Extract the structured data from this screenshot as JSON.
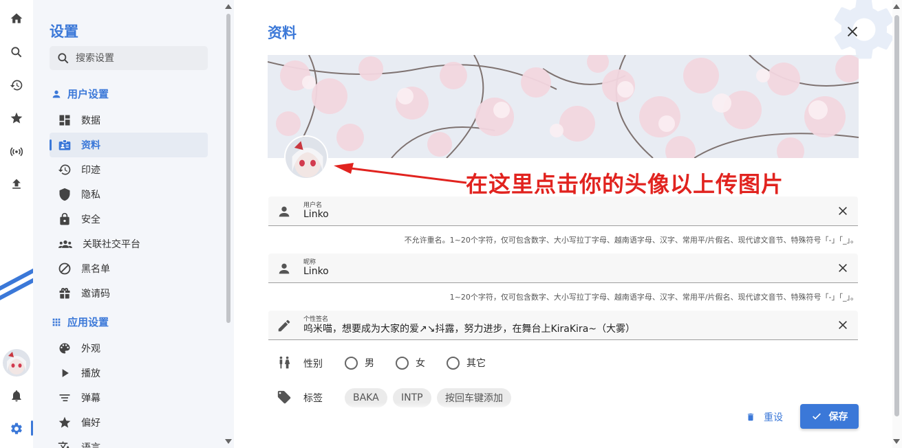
{
  "colors": {
    "accent": "#3b78d8",
    "annotation": "#e1231f",
    "sidebar_bg": "#f4f6fa"
  },
  "rail": {
    "icons": [
      "home-icon",
      "search-icon",
      "history-icon",
      "star-icon",
      "live-icon",
      "upload-icon",
      "bell-icon",
      "gear-icon"
    ]
  },
  "sidebar": {
    "title": "设置",
    "search_placeholder": "搜索设置",
    "sections": [
      {
        "label": "用户设置",
        "icon": "person-icon",
        "items": [
          {
            "label": "数据",
            "icon": "dashboard-icon"
          },
          {
            "label": "资料",
            "icon": "id-card-icon",
            "active": true
          },
          {
            "label": "印迹",
            "icon": "history-icon"
          },
          {
            "label": "隐私",
            "icon": "shield-icon"
          },
          {
            "label": "安全",
            "icon": "lock-icon"
          },
          {
            "label": "关联社交平台",
            "icon": "group-icon"
          },
          {
            "label": "黑名单",
            "icon": "block-icon"
          },
          {
            "label": "邀请码",
            "icon": "gift-icon"
          }
        ]
      },
      {
        "label": "应用设置",
        "icon": "apps-icon",
        "items": [
          {
            "label": "外观",
            "icon": "palette-icon"
          },
          {
            "label": "播放",
            "icon": "play-icon"
          },
          {
            "label": "弹幕",
            "icon": "danmaku-icon"
          },
          {
            "label": "偏好",
            "icon": "star-icon"
          },
          {
            "label": "语言",
            "icon": "translate-icon"
          }
        ]
      }
    ]
  },
  "main": {
    "title": "资料",
    "annotation": "在这里点击你的头像以上传图片",
    "fields": {
      "username": {
        "label": "用户名",
        "value": "Linko",
        "hint": "不允许重名。1~20个字符，仅可包含数字、大小写拉丁字母、越南语字母、汉字、常用平/片假名、现代谚文音节、特殊符号「-」「_」。"
      },
      "nickname": {
        "label": "昵称",
        "value": "Linko",
        "hint": "1~20个字符，仅可包含数字、大小写拉丁字母、越南语字母、汉字、常用平/片假名、现代谚文音节、特殊符号「-」「_」。"
      },
      "signature": {
        "label": "个性签名",
        "value": "呜米喵，想要成为大家的爱↗↘抖露，努力进步，在舞台上KiraKira~（大雾）"
      }
    },
    "gender": {
      "label": "性别",
      "options": [
        "男",
        "女",
        "其它"
      ]
    },
    "tags": {
      "label": "标签",
      "items": [
        "BAKA",
        "INTP",
        "按回车键添加"
      ]
    },
    "buttons": {
      "reset": "重设",
      "save": "保存"
    }
  }
}
